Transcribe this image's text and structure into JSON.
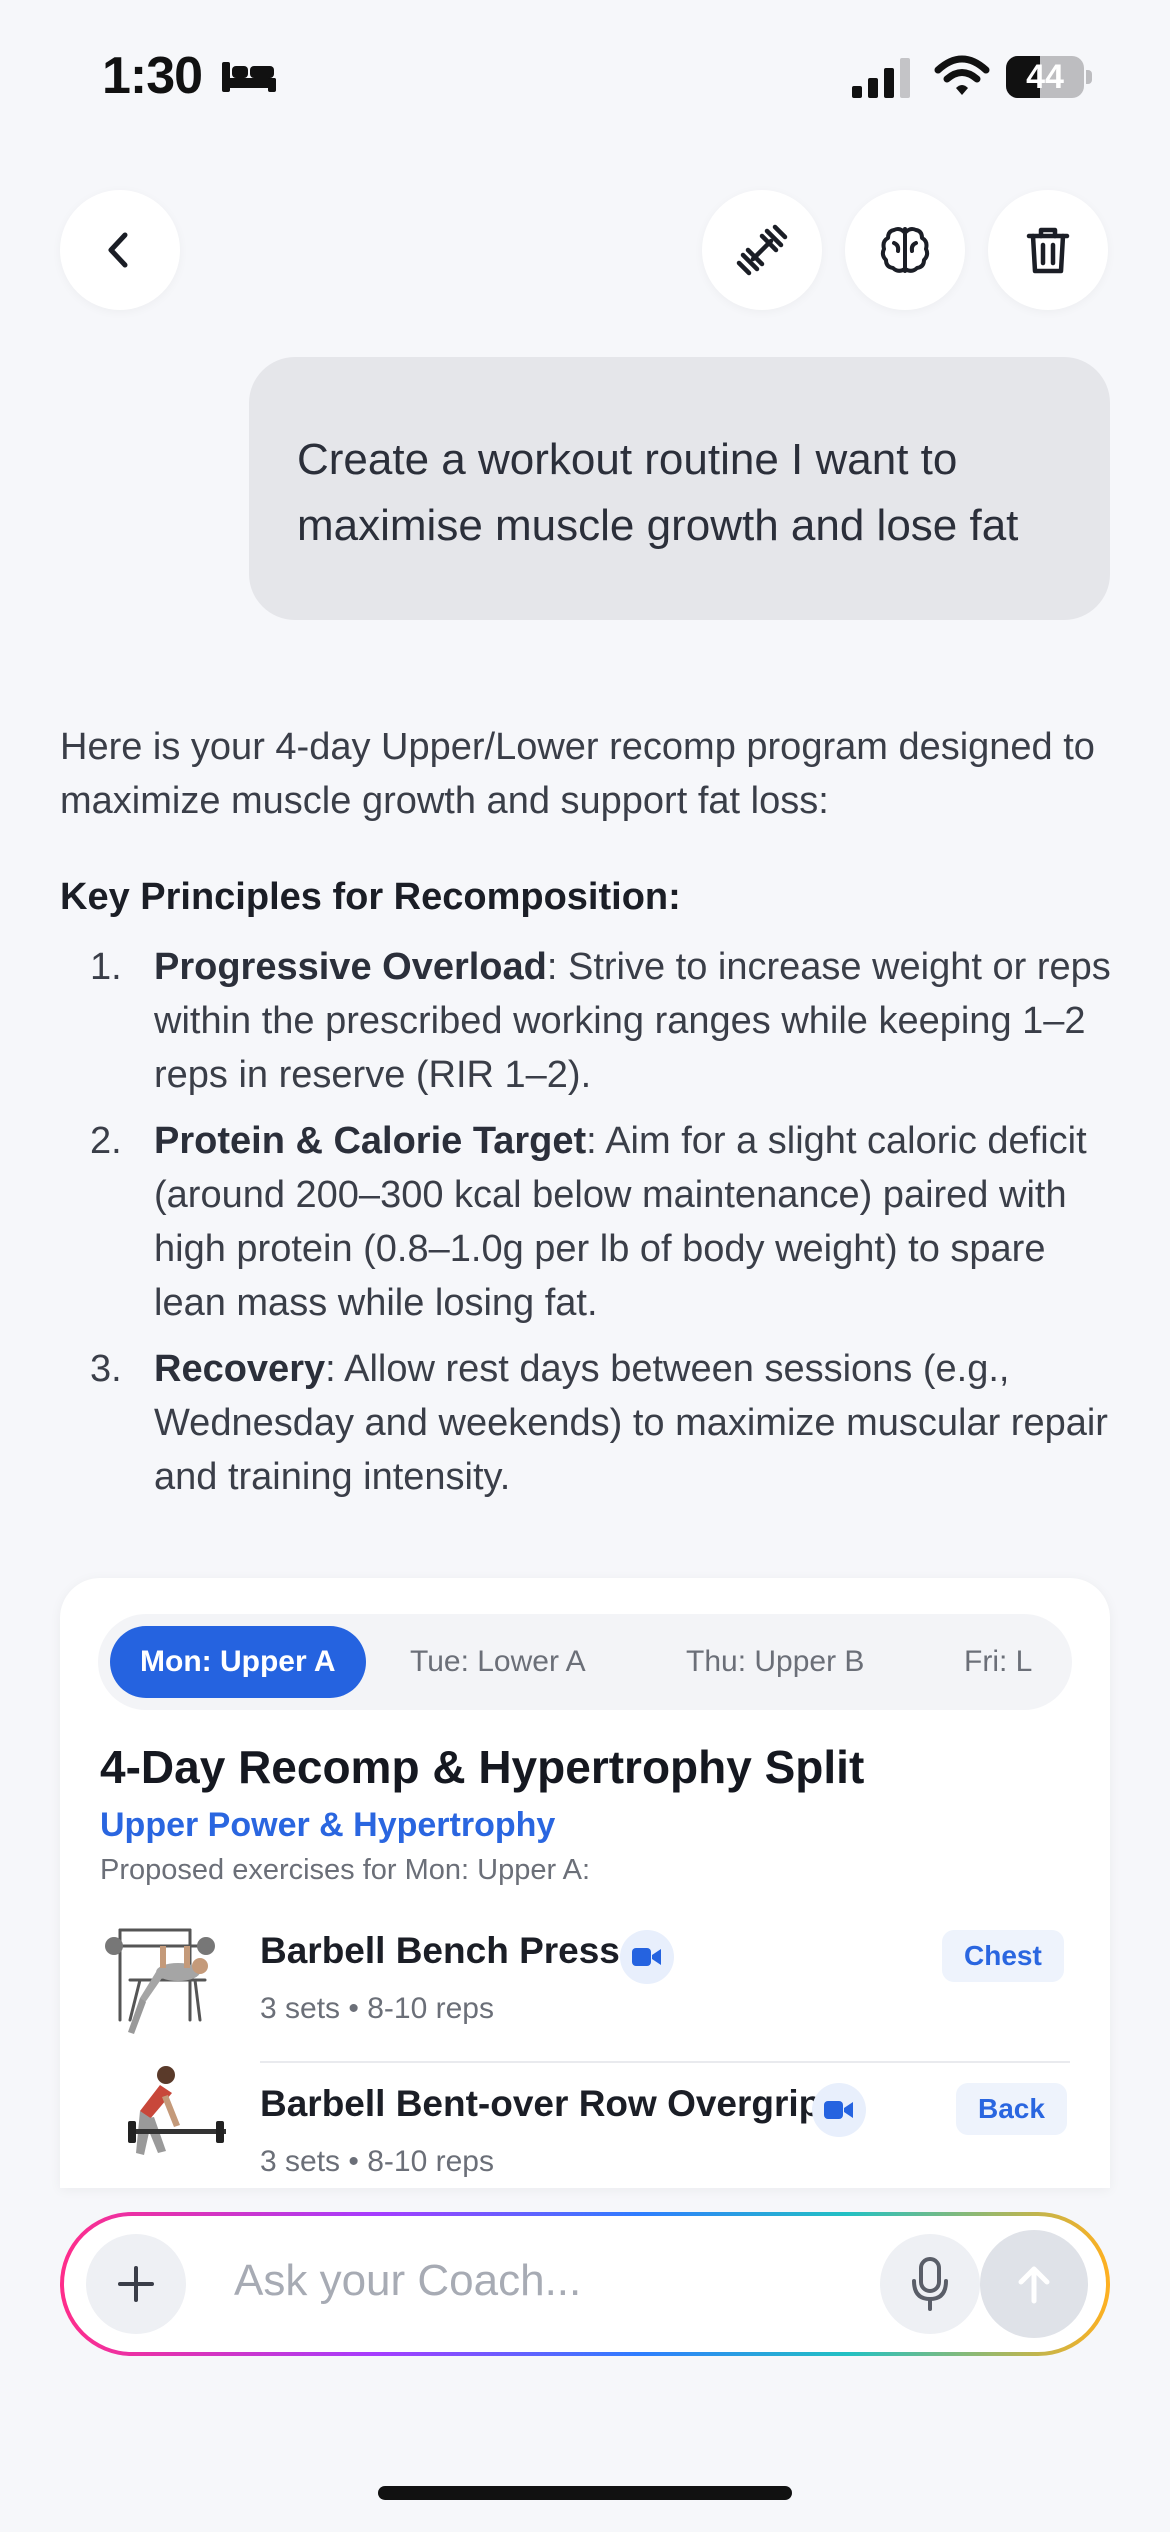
{
  "status_bar": {
    "time": "1:30",
    "battery_level": "44",
    "battery_fraction": 0.44
  },
  "header": {
    "back_icon": "chevron-left-icon",
    "workout_icon": "dumbbell-icon",
    "memory_icon": "brain-icon",
    "delete_icon": "trash-icon"
  },
  "user_message": "Create a workout routine I want to maximise muscle growth and lose fat",
  "assistant": {
    "intro": "Here is your 4-day Upper/Lower recomp program designed to maximize muscle growth and support fat loss:",
    "principles_title": "Key Principles for Recomposition:",
    "principles": [
      {
        "num": "1.",
        "title": "Progressive Overload",
        "text": ": Strive to increase weight or reps within the prescribed working ranges while keeping 1–2 reps in reserve (RIR 1–2)."
      },
      {
        "num": "2.",
        "title": "Protein & Calorie Target",
        "text": ": Aim for a slight caloric deficit (around 200–300 kcal below maintenance) paired with high protein (0.8–1.0g per lb of body weight) to spare lean mass while losing fat."
      },
      {
        "num": "3.",
        "title": "Recovery",
        "text": ": Allow rest days between sessions (e.g., Wednesday and weekends) to maximize muscular repair and training intensity."
      }
    ]
  },
  "workout_card": {
    "tabs": [
      {
        "label": "Mon: Upper A",
        "active": true
      },
      {
        "label": "Tue: Lower A",
        "active": false
      },
      {
        "label": "Thu: Upper B",
        "active": false
      },
      {
        "label": "Fri: L",
        "active": false
      }
    ],
    "title": "4-Day Recomp & Hypertrophy Split",
    "subtitle": "Upper Power & Hypertrophy",
    "caption": "Proposed exercises for Mon: Upper A:",
    "exercises": [
      {
        "name": "Barbell Bench Press",
        "meta": "3 sets • 8-10 reps",
        "muscle": "Chest",
        "video_icon": "video-camera-icon"
      },
      {
        "name": "Barbell Bent-over Row Overgrip",
        "meta": "3 sets • 8-10 reps",
        "muscle": "Back",
        "video_icon": "video-camera-icon"
      }
    ]
  },
  "input": {
    "placeholder": "Ask your Coach...",
    "add_icon": "plus-icon",
    "mic_icon": "microphone-icon",
    "send_icon": "arrow-up-icon"
  },
  "colors": {
    "accent": "#2563e0",
    "background": "#f6f7fa",
    "bubble": "#e5e6ea"
  }
}
